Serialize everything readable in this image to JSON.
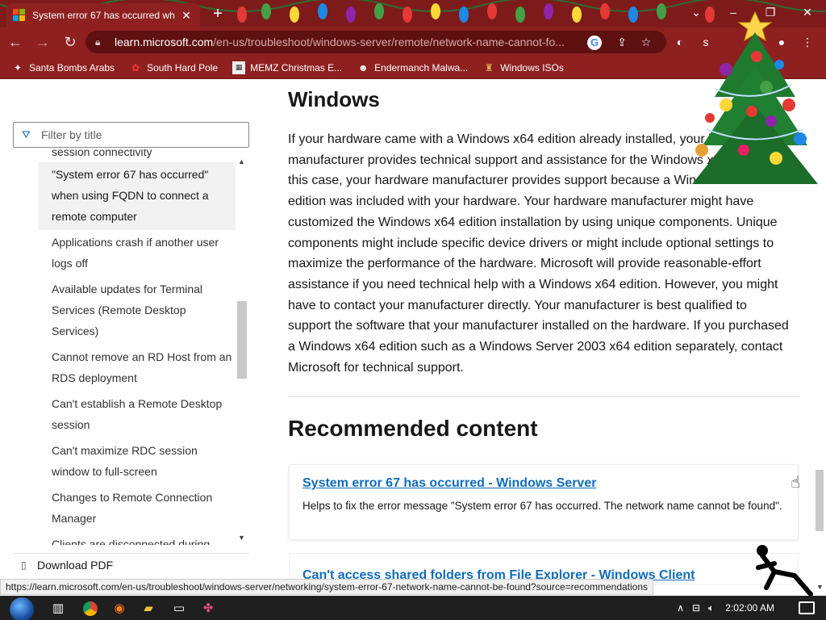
{
  "browser": {
    "tab": {
      "title": "System error 67 has occurred wh",
      "close": "✕"
    },
    "new_tab": "+",
    "window_controls": [
      "⌄",
      "–",
      "❐",
      "✕"
    ],
    "toolbar": {
      "back": "←",
      "forward": "→",
      "reload": "↻",
      "url_host": "learn.microsoft.com",
      "url_path": "/en-us/troubleshoot/windows-server/remote/network-name-cannot-fo..."
    },
    "bookmarks": [
      {
        "label": "Santa Bombs Arabs",
        "icon": "bomb-icon"
      },
      {
        "label": "South Hard Pole",
        "icon": "red-flower-icon"
      },
      {
        "label": "MEMZ Christmas E...",
        "icon": "memz-icon"
      },
      {
        "label": "Endermanch Malwa...",
        "icon": "endermanch-icon"
      },
      {
        "label": "Windows ISOs",
        "icon": "figure-icon"
      }
    ]
  },
  "sidebar": {
    "filter_placeholder": "Filter by title",
    "partial_item": "session connectivity",
    "items": [
      {
        "label": "\"System error 67 has occurred\" when using FQDN to connect a remote computer",
        "selected": true
      },
      {
        "label": "Applications crash if another user logs off"
      },
      {
        "label": "Available updates for Terminal Services (Remote Desktop Services)"
      },
      {
        "label": "Cannot remove an RD Host from an RDS deployment"
      },
      {
        "label": "Can't establish a Remote Desktop session"
      },
      {
        "label": "Can't maximize RDC session window to full-screen"
      },
      {
        "label": "Changes to Remote Connection Manager"
      },
      {
        "label": "Clients are disconnected during Group Policy update"
      }
    ],
    "download_pdf": "Download PDF"
  },
  "article": {
    "heading": "Windows",
    "paragraph": "If your hardware came with a Windows x64 edition already installed, your hardware manufacturer provides technical support and assistance for the Windows x64 edition. In this case, your hardware manufacturer provides support because a Windows x64 edition was included with your hardware. Your hardware manufacturer might have customized the Windows x64 edition installation by using unique components. Unique components might include specific device drivers or might include optional settings to maximize the performance of the hardware. Microsoft will provide reasonable-effort assistance if you need technical help with a Windows x64 edition. However, you might have to contact your manufacturer directly. Your manufacturer is best qualified to support the software that your manufacturer installed on the hardware. If you purchased a Windows x64 edition such as a Windows Server 2003 x64 edition separately, contact Microsoft for technical support.",
    "recommended_heading": "Recommended content",
    "recommended": [
      {
        "title": "System error 67 has occurred - Windows Server",
        "description": "Helps to fix the error message \"System error 67 has occurred. The network name cannot be found\"."
      },
      {
        "title": "Can't access shared folders from File Explorer - Windows Client"
      }
    ]
  },
  "status_url": "https://learn.microsoft.com/en-us/troubleshoot/windows-server/networking/system-error-67-network-name-cannot-be-found?source=recommendations",
  "taskbar": {
    "clock": "2:02:00 AM",
    "tray_icons": [
      "chevron-up-icon",
      "network-icon",
      "volume-icon",
      "notification-icon"
    ]
  },
  "colors": {
    "chrome_red": "#8e2020",
    "link_blue": "#0f6cbd",
    "ms_logo": [
      "#f25022",
      "#7fba00",
      "#00a4ef",
      "#ffb900"
    ]
  }
}
